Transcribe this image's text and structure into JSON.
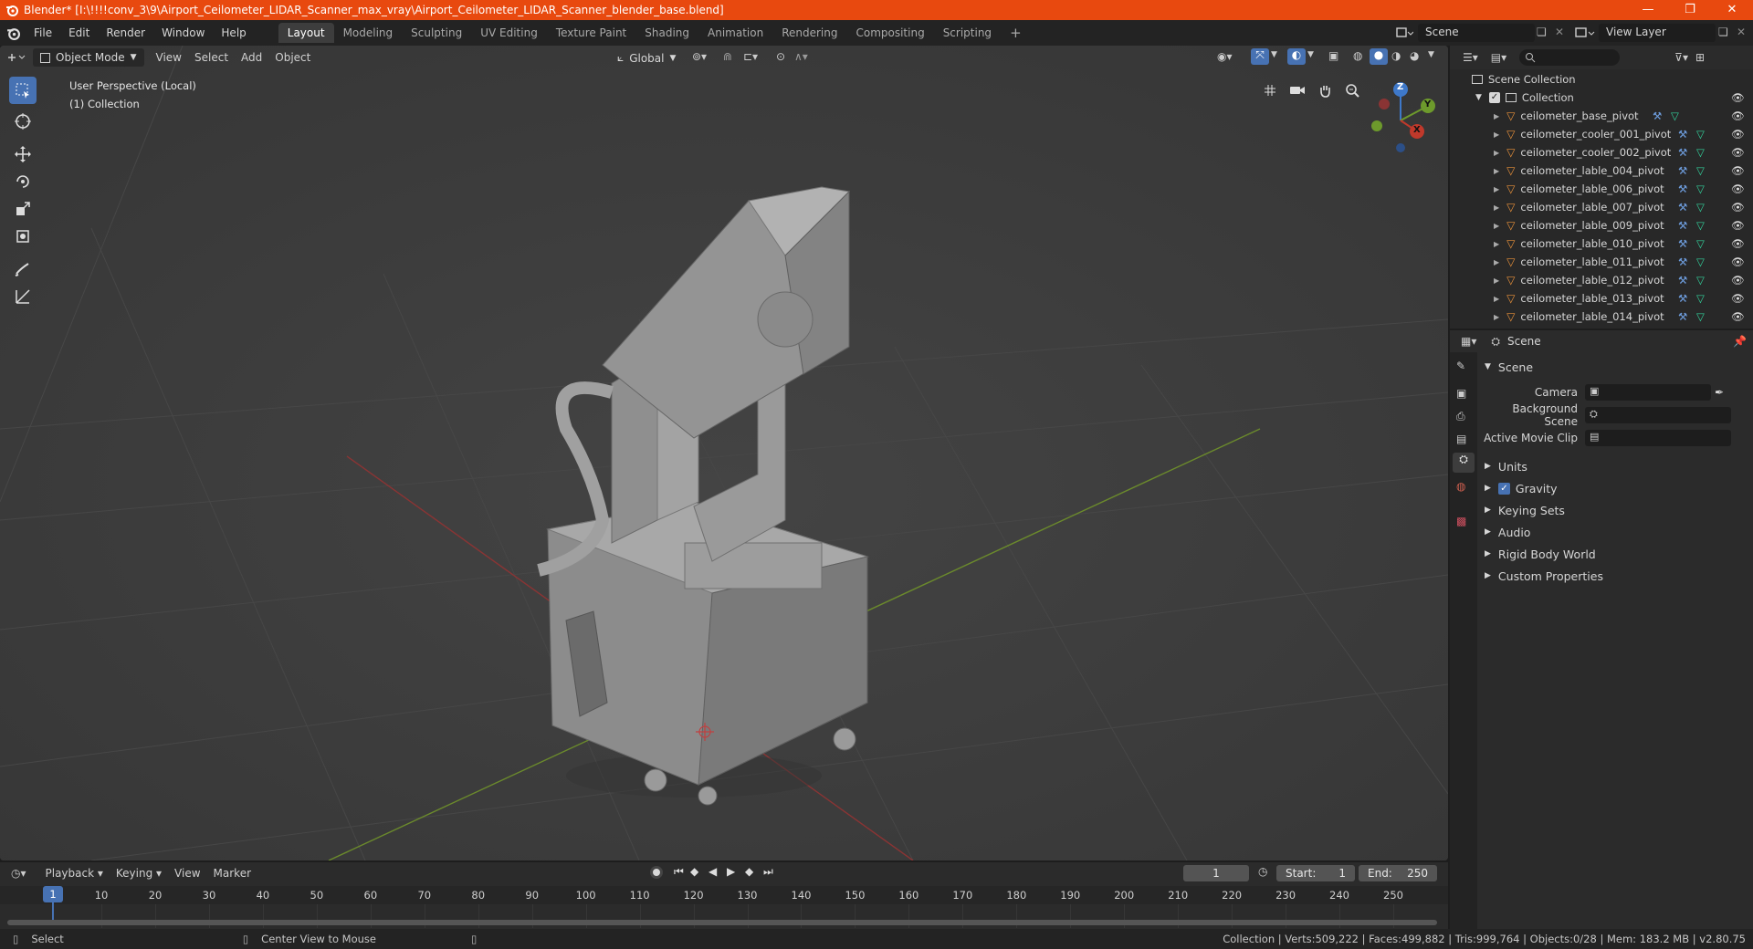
{
  "window": {
    "title": "Blender* [I:\\!!!!conv_3\\9\\Airport_Ceilometer_LIDAR_Scanner_max_vray\\Airport_Ceilometer_LIDAR_Scanner_blender_base.blend]",
    "minimize_glyph": "—",
    "maximize_glyph": "❐",
    "close_glyph": "✕"
  },
  "menu": {
    "items": [
      "File",
      "Edit",
      "Render",
      "Window",
      "Help"
    ],
    "workspaces": [
      "Layout",
      "Modeling",
      "Sculpting",
      "UV Editing",
      "Texture Paint",
      "Shading",
      "Animation",
      "Rendering",
      "Compositing",
      "Scripting"
    ],
    "active_workspace": "Layout",
    "add_tab": "+",
    "scene_name": "Scene",
    "view_layer": "View Layer"
  },
  "viewport": {
    "mode": "Object Mode",
    "menus": [
      "View",
      "Select",
      "Add",
      "Object"
    ],
    "transform_orientation": "Global",
    "overlay_line1": "User Perspective (Local)",
    "overlay_line2": "(1) Collection",
    "gizmo_labels": {
      "z": "Z",
      "y": "Y",
      "x": "X"
    }
  },
  "outliner": {
    "root": "Scene Collection",
    "collection": "Collection",
    "objects": [
      "ceilometer_base_pivot",
      "ceilometer_cooler_001_pivot",
      "ceilometer_cooler_002_pivot",
      "ceilometer_lable_004_pivot",
      "ceilometer_lable_006_pivot",
      "ceilometer_lable_007_pivot",
      "ceilometer_lable_009_pivot",
      "ceilometer_lable_010_pivot",
      "ceilometer_lable_011_pivot",
      "ceilometer_lable_012_pivot",
      "ceilometer_lable_013_pivot",
      "ceilometer_lable_014_pivot"
    ]
  },
  "properties": {
    "header": "Scene",
    "panel_title": "Scene",
    "fields": [
      {
        "label": "Camera",
        "value": ""
      },
      {
        "label": "Background Scene",
        "value": ""
      },
      {
        "label": "Active Movie Clip",
        "value": ""
      }
    ],
    "subpanels": [
      "Units",
      "Gravity",
      "Keying Sets",
      "Audio",
      "Rigid Body World",
      "Custom Properties"
    ],
    "gravity_checked": true
  },
  "timeline": {
    "menus": [
      "Playback",
      "Keying",
      "View",
      "Marker"
    ],
    "current_frame": "1",
    "start_label": "Start:",
    "start": "1",
    "end_label": "End:",
    "end": "250",
    "ticks": [
      "1",
      "10",
      "20",
      "30",
      "40",
      "50",
      "60",
      "70",
      "80",
      "90",
      "100",
      "110",
      "120",
      "130",
      "140",
      "150",
      "160",
      "170",
      "180",
      "190",
      "200",
      "210",
      "220",
      "230",
      "240",
      "250"
    ]
  },
  "statusbar": {
    "left_action": "Select",
    "middle_action": "Center View to Mouse",
    "stats": "Collection | Verts:509,222 | Faces:499,882 | Tris:999,764 | Objects:0/28 | Mem: 183.2 MB | v2.80.75"
  },
  "colors": {
    "title_bar": "#e8490f",
    "viewport_bg": "#3d3d3d",
    "panel_bg": "#282828",
    "accent_blue": "#4772b3",
    "mesh_orange": "#e8913a",
    "modifier_blue": "#6f9fe0",
    "data_green": "#32d29c"
  }
}
